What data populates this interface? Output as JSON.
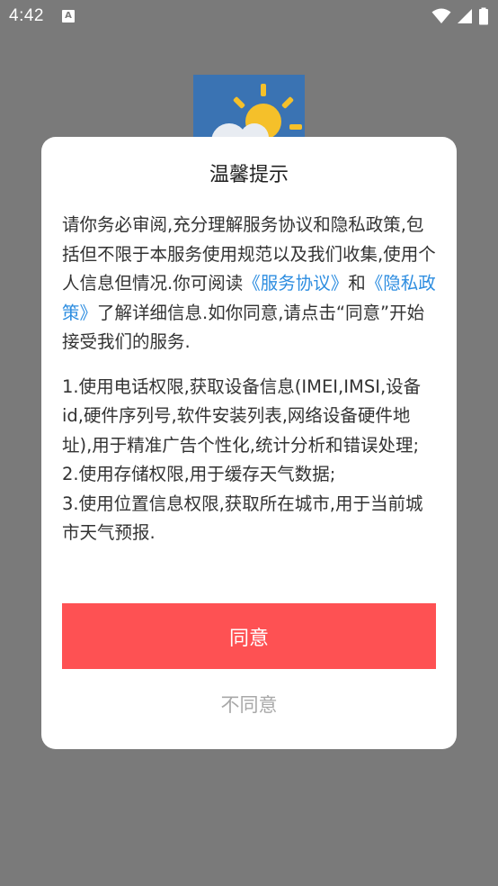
{
  "status_bar": {
    "time": "4:42",
    "notification_icon_letter": "A",
    "icons": [
      "wifi-icon",
      "signal-icon",
      "battery-icon"
    ]
  },
  "app_logo": {
    "icon": "weather-sun-cloud-icon"
  },
  "dialog": {
    "title": "温馨提示",
    "intro_part1": "请你务必审阅,充分理解服务协议和隐私政策,包括但不限于本服务使用规范以及我们收集,使用个人信息但情况.你可阅读",
    "service_agreement_link": "《服务协议》",
    "and_text": "和",
    "privacy_policy_link": "《隐私政策》",
    "intro_part2": "了解详细信息.如你同意,请点击“同意”开始接受我们的服务.",
    "permissions": [
      "1.使用电话权限,获取设备信息(IMEI,IMSI,设备id,硬件序列号,软件安装列表,网络设备硬件地址),用于精准广告个性化,统计分析和错误处理;",
      "2.使用存储权限,用于缓存天气数据;",
      "3.使用位置信息权限,获取所在城市,用于当前城市天气预报."
    ],
    "agree_label": "同意",
    "disagree_label": "不同意"
  },
  "colors": {
    "overlay": "#7a7a7a",
    "accent": "#fe5153",
    "link": "#2d8de0",
    "muted": "#a8a8a8"
  }
}
